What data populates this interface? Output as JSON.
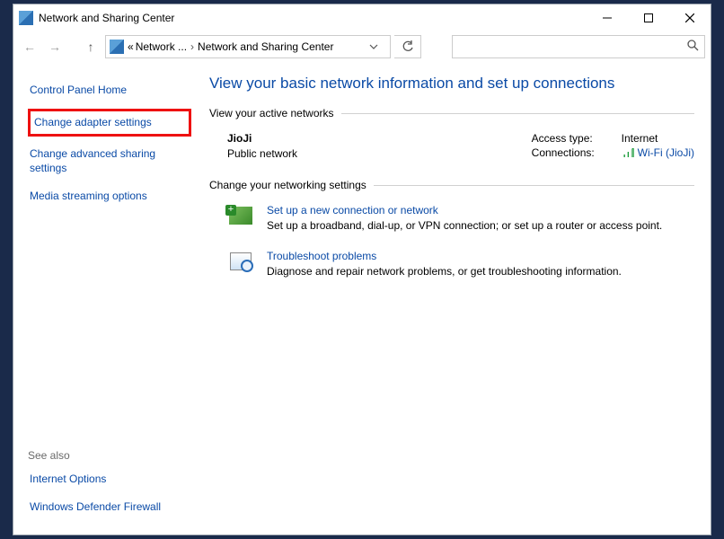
{
  "window": {
    "title": "Network and Sharing Center"
  },
  "breadcrumb": {
    "prefix": "«",
    "seg1": "Network ...",
    "seg2": "Network and Sharing Center"
  },
  "sidebar": {
    "home": "Control Panel Home",
    "adapter": "Change adapter settings",
    "advanced": "Change advanced sharing settings",
    "media": "Media streaming options",
    "see_also_hdr": "See also",
    "internet_options": "Internet Options",
    "firewall": "Windows Defender Firewall"
  },
  "main": {
    "page_title": "View your basic network information and set up connections",
    "active_hdr": "View your active networks",
    "network": {
      "name": "JioJi",
      "type": "Public network",
      "access_label": "Access type:",
      "access_value": "Internet",
      "conn_label": "Connections:",
      "conn_value": "Wi-Fi (JioJi)"
    },
    "settings_hdr": "Change your networking settings",
    "setup": {
      "title": "Set up a new connection or network",
      "desc": "Set up a broadband, dial-up, or VPN connection; or set up a router or access point."
    },
    "trouble": {
      "title": "Troubleshoot problems",
      "desc": "Diagnose and repair network problems, or get troubleshooting information."
    }
  }
}
